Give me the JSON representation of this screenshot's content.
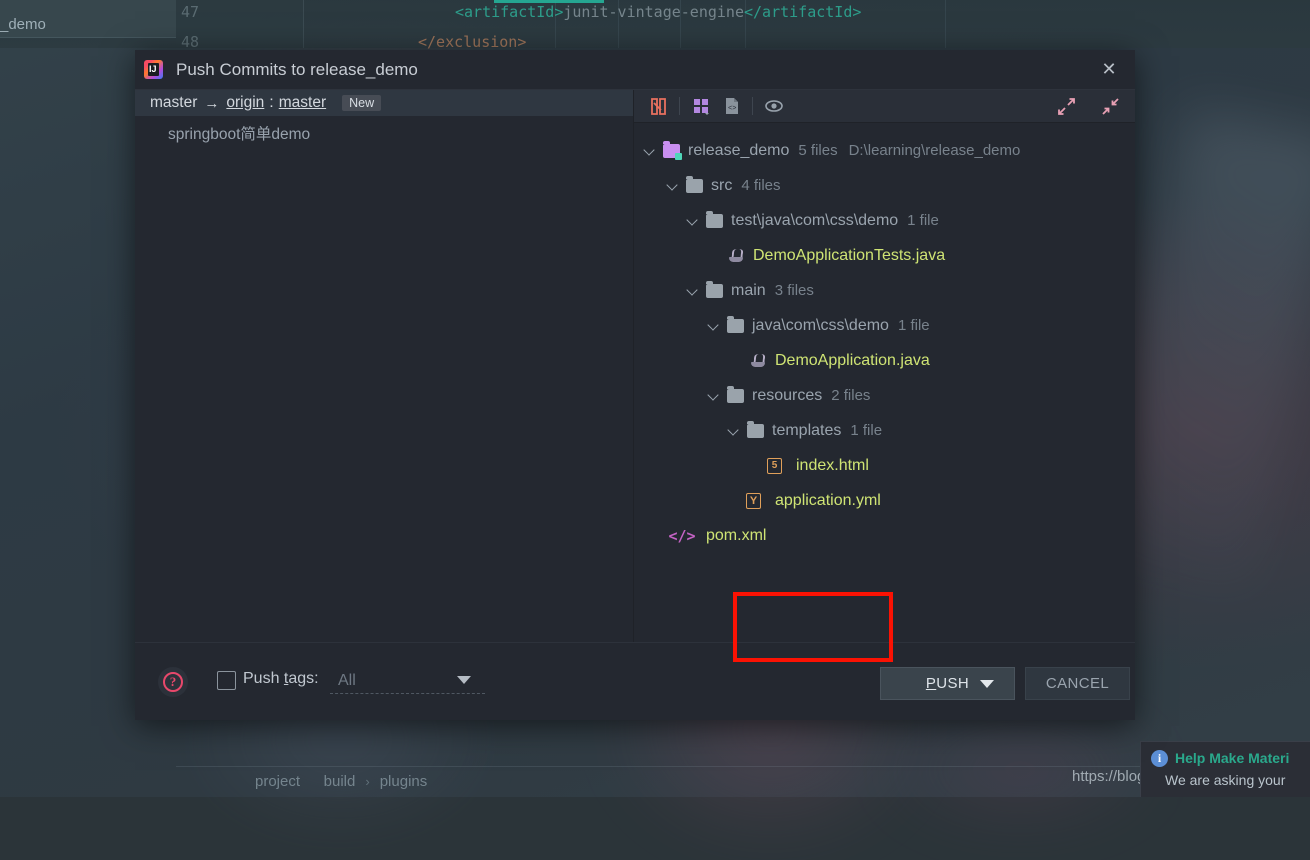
{
  "background": {
    "tab_label": "_demo",
    "line_numbers": [
      "47",
      "48"
    ],
    "code_47": "<artifactId>junit-vintage-engine</artifactId>",
    "code_48": "</exclusion>",
    "breadcrumb": [
      "project",
      "build",
      "plugins"
    ],
    "breadcrumb_separator": "›",
    "watermark": "https://blog.csdn.net/I_am_css",
    "toast": {
      "icon": "info-icon",
      "icon_glyph": "i",
      "title": "Help Make Materi",
      "body": "We are asking your"
    }
  },
  "dialog": {
    "title": "Push Commits to release_demo",
    "app_icon": "intellij-idea-icon",
    "close_icon": "✕",
    "commits": {
      "branch": {
        "local": "master",
        "arrow": "→",
        "remote_origin": "origin",
        "colon": ":",
        "remote_branch": "master",
        "badge": "New"
      },
      "message": "springboot简单demo"
    },
    "files_toolbar": {
      "buttons": [
        {
          "name": "diff-preview-icon",
          "title": "Show Diff Preview"
        },
        {
          "name": "group-by-icon",
          "title": "Group By"
        },
        {
          "name": "file-details-icon",
          "title": "File Details"
        },
        {
          "name": "preview-eye-icon",
          "title": "Preview"
        }
      ],
      "expand_all_icon": "expand-all-icon",
      "collapse_all_icon": "collapse-all-icon"
    },
    "tree": [
      {
        "indent": 0,
        "chevron": true,
        "icon": "folder-root-icon",
        "name": "release_demo",
        "count": "5 files",
        "path": "D:\\learning\\release_demo"
      },
      {
        "indent": 1,
        "chevron": true,
        "icon": "folder-icon",
        "name": "src",
        "count": "4 files",
        "path": ""
      },
      {
        "indent": 2,
        "chevron": true,
        "icon": "folder-icon",
        "name": "test\\java\\com\\css\\demo",
        "count": "1 file",
        "path": ""
      },
      {
        "indent": 3,
        "chevron": false,
        "icon": "java-file-icon",
        "name": "DemoApplicationTests.java",
        "count": "",
        "path": "",
        "kind": "java"
      },
      {
        "indent": 2,
        "chevron": true,
        "icon": "folder-icon",
        "name": "main",
        "count": "3 files",
        "path": ""
      },
      {
        "indent": 3,
        "chevron": true,
        "icon": "folder-icon",
        "name": "java\\com\\css\\demo",
        "count": "1 file",
        "path": ""
      },
      {
        "indent": 4,
        "chevron": false,
        "icon": "java-file-icon",
        "name": "DemoApplication.java",
        "count": "",
        "path": "",
        "kind": "java"
      },
      {
        "indent": 3,
        "chevron": true,
        "icon": "folder-icon",
        "name": "resources",
        "count": "2 files",
        "path": ""
      },
      {
        "indent": 4,
        "chevron": true,
        "icon": "folder-icon",
        "name": "templates",
        "count": "1 file",
        "path": ""
      },
      {
        "indent": 5,
        "chevron": false,
        "icon": "html-file-icon",
        "name": "index.html",
        "count": "",
        "path": "",
        "kind": "html",
        "glyph": "5"
      },
      {
        "indent": 4,
        "chevron": false,
        "icon": "yml-file-icon",
        "name": "application.yml",
        "count": "",
        "path": "",
        "kind": "yml",
        "glyph": "Y"
      },
      {
        "indent": 1,
        "chevron": false,
        "icon": "xml-file-icon",
        "name": "pom.xml",
        "count": "",
        "path": "",
        "kind": "xml",
        "glyph": "</>"
      }
    ],
    "footer": {
      "help_icon": "help-icon",
      "help_glyph": "?",
      "push_tags_label": "Push tags:",
      "push_tags_mnemonic": "t",
      "push_tags_checked": false,
      "tags_select_value": "All",
      "push_label": "PUSH",
      "push_mnemonic": "P",
      "cancel_label": "CANCEL"
    }
  },
  "annotation": {
    "color": "#fb1203",
    "target": "push-button"
  }
}
